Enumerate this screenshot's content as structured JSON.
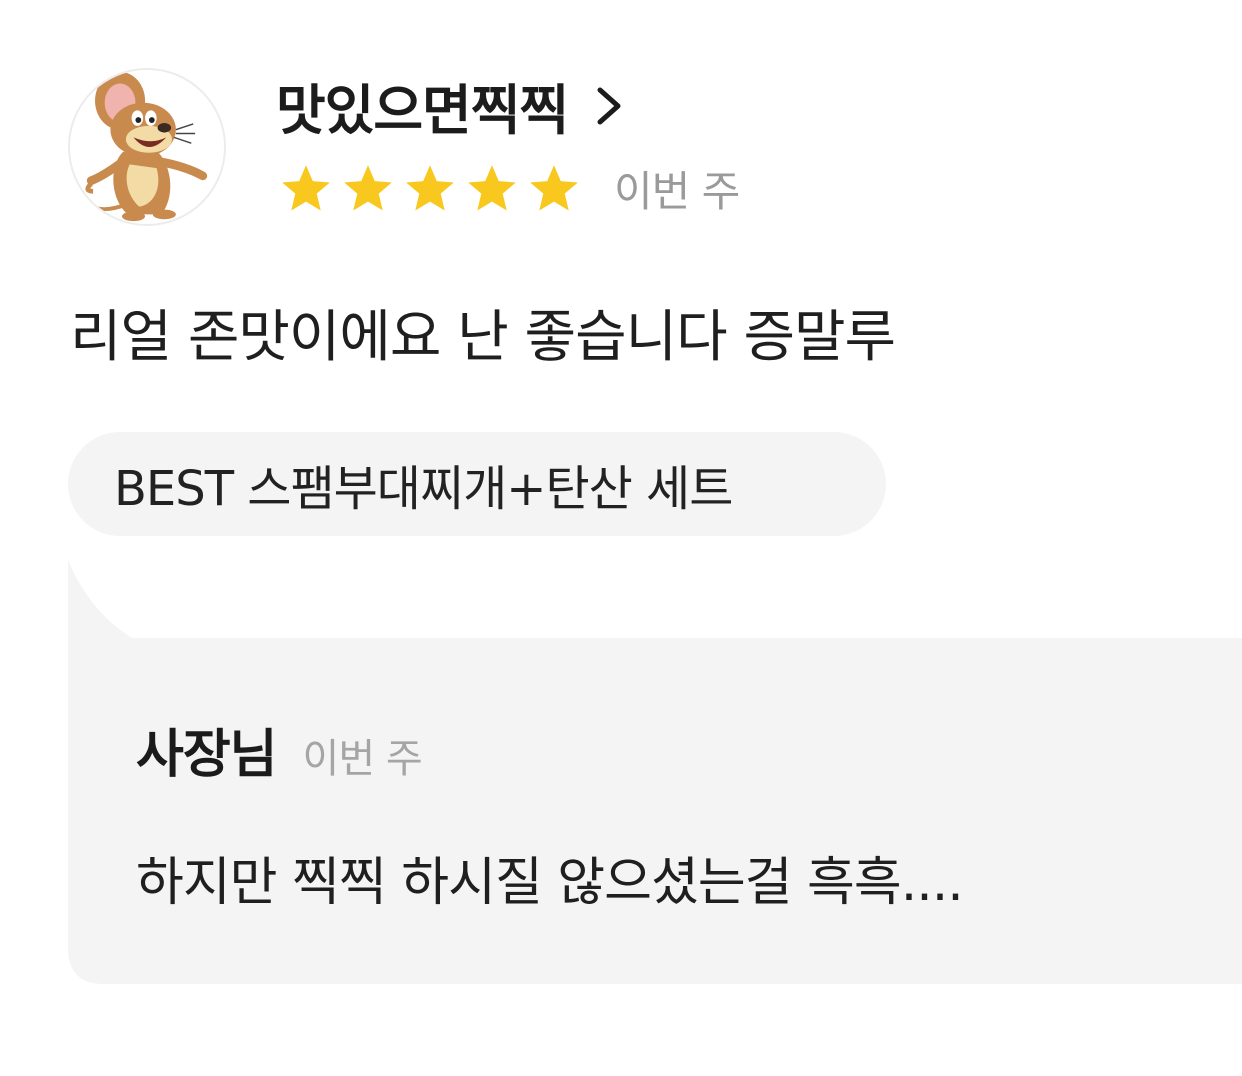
{
  "review": {
    "avatar_icon": "mouse-character-avatar",
    "nickname": "맛있으면찍찍",
    "chevron_icon": "chevron-right-icon",
    "rating": 5,
    "rating_max": 5,
    "star_color": "#f9c81e",
    "date": "이번 주",
    "text": "리얼 존맛이에요 난 좋습니다 증말루",
    "menu_chip": "BEST 스팸부대찌개+탄산 세트"
  },
  "owner_reply": {
    "name": "사장님",
    "date": "이번 주",
    "text": "하지만 찍찍 하시질 않으셨는걸 흑흑...."
  }
}
